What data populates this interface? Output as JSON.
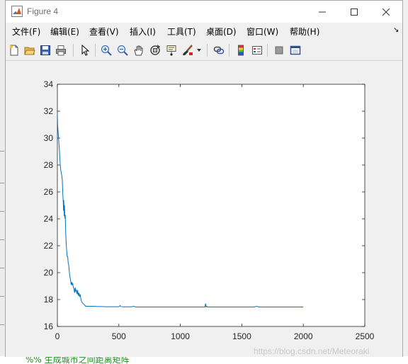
{
  "window": {
    "title": "Figure 4"
  },
  "menu": {
    "items": [
      "文件(F)",
      "编辑(E)",
      "查看(V)",
      "插入(I)",
      "工具(T)",
      "桌面(D)",
      "窗口(W)",
      "帮助(H)"
    ]
  },
  "toolbar": {
    "icons": [
      "new-figure-icon",
      "open-file-icon",
      "save-icon",
      "print-icon",
      "select-pointer-icon",
      "zoom-in-icon",
      "zoom-out-icon",
      "pan-hand-icon",
      "rotate-3d-icon",
      "data-cursor-icon",
      "brush-icon",
      "link-plot-icon",
      "colorbar-icon",
      "legend-icon",
      "hide-plot-tools-icon",
      "show-plot-tools-icon"
    ]
  },
  "chart_data": {
    "type": "line",
    "title": "",
    "xlabel": "",
    "ylabel": "",
    "xlim": [
      0,
      2500
    ],
    "ylim": [
      16,
      34
    ],
    "x_ticks": [
      0,
      500,
      1000,
      1500,
      2000,
      2500
    ],
    "y_ticks": [
      16,
      18,
      20,
      22,
      24,
      26,
      28,
      30,
      32,
      34
    ],
    "grid": false,
    "color": "#0072bd",
    "series": [
      {
        "x": [
          0,
          2,
          5,
          8,
          12,
          16,
          20,
          24,
          28,
          32,
          36,
          40,
          44,
          48,
          50,
          52,
          54,
          56,
          58,
          60,
          62,
          64,
          66,
          68,
          72,
          76,
          80,
          84,
          88,
          92,
          96,
          100,
          104,
          108,
          112,
          116,
          120,
          125,
          130,
          135,
          140,
          145,
          150,
          155,
          160,
          165,
          170,
          175,
          180,
          185,
          190,
          195,
          200,
          210,
          220,
          230,
          240,
          250,
          260,
          280,
          300,
          330,
          360,
          400,
          450,
          500,
          510,
          520,
          540,
          600,
          620,
          640,
          700,
          800,
          900,
          1000,
          1100,
          1200,
          1205,
          1210,
          1215,
          1220,
          1300,
          1400,
          1500,
          1600,
          1620,
          1640,
          1700,
          1800,
          1900,
          2000
        ],
        "y": [
          31.8,
          31.0,
          30.6,
          30.2,
          29.7,
          29.2,
          28.5,
          27.9,
          27.6,
          27.4,
          27.2,
          26.9,
          25.9,
          25.2,
          24.6,
          25.4,
          24.8,
          24.2,
          25.0,
          24.3,
          24.0,
          24.3,
          23.6,
          22.9,
          22.1,
          21.6,
          21.2,
          21.2,
          20.7,
          20.6,
          20.2,
          19.8,
          19.6,
          19.4,
          19.1,
          19.3,
          19.1,
          19.2,
          18.9,
          18.8,
          18.5,
          18.9,
          18.6,
          18.7,
          18.4,
          18.7,
          18.3,
          18.5,
          18.2,
          18.4,
          18.1,
          17.9,
          17.8,
          17.7,
          17.6,
          17.5,
          17.5,
          17.5,
          17.5,
          17.5,
          17.5,
          17.48,
          17.48,
          17.47,
          17.47,
          17.47,
          17.55,
          17.47,
          17.46,
          17.46,
          17.5,
          17.45,
          17.45,
          17.45,
          17.45,
          17.45,
          17.45,
          17.45,
          17.7,
          17.45,
          17.5,
          17.45,
          17.45,
          17.45,
          17.45,
          17.45,
          17.5,
          17.45,
          17.45,
          17.45,
          17.45,
          17.45
        ]
      }
    ]
  },
  "background": {
    "code_comment": "%% 生成城市之间距离矩阵",
    "watermark": "https://blog.csdn.net/Meteoraki"
  }
}
